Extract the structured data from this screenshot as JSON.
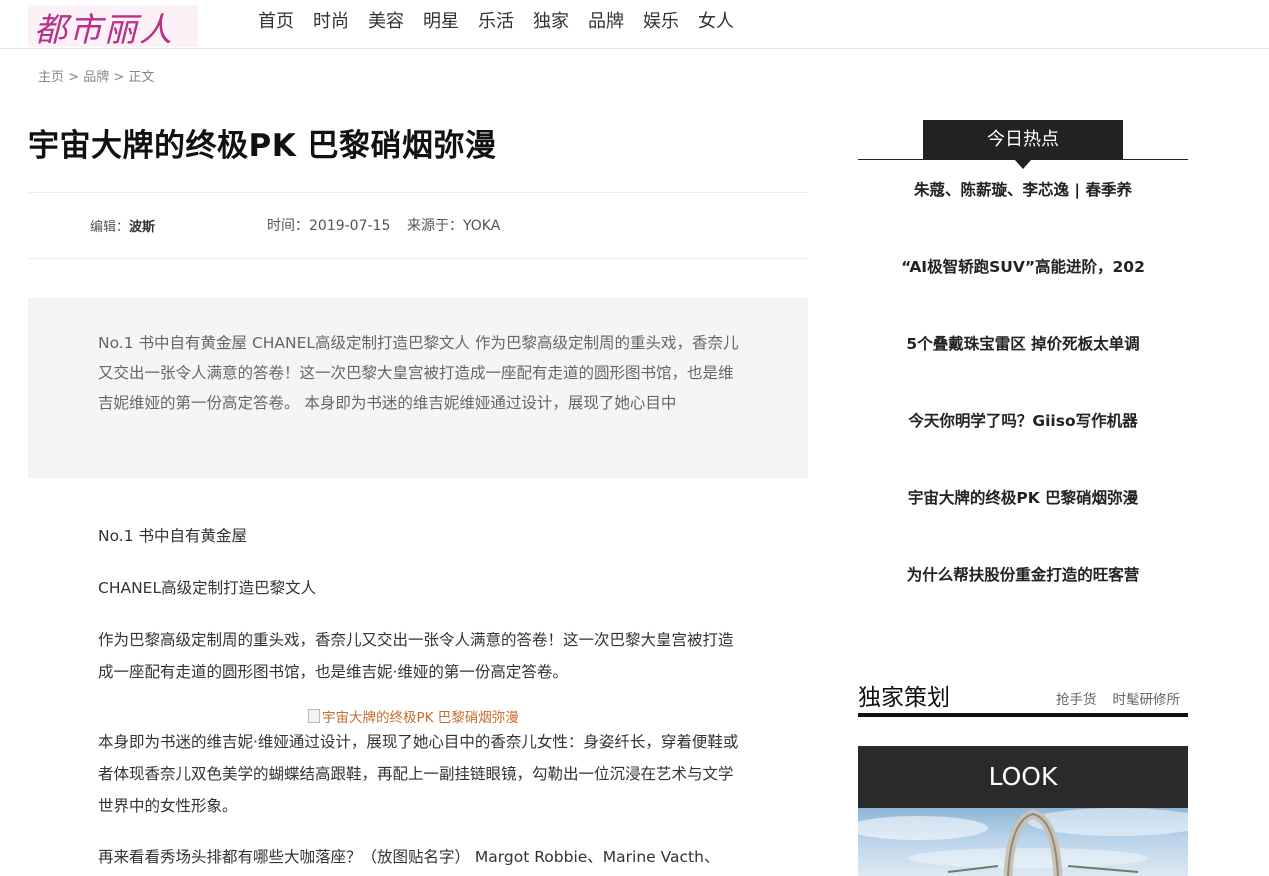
{
  "header": {
    "logo_text": "都市丽人",
    "nav": [
      "首页",
      "时尚",
      "美容",
      "明星",
      "乐活",
      "独家",
      "品牌",
      "娱乐",
      "女人"
    ]
  },
  "breadcrumb": {
    "home": "主页",
    "sep1": ">",
    "category": "品牌",
    "sep2": ">",
    "current": "正文"
  },
  "article": {
    "title": "宇宙大牌的终极PK 巴黎硝烟弥漫",
    "editor_label": "编辑：",
    "editor_name": "波斯",
    "time": "时间：2019-07-15",
    "source": "来源于：YOKA",
    "summary": "No.1 书中自有黄金屋 CHANEL高级定制打造巴黎文人 作为巴黎高级定制周的重头戏，香奈儿又交出一张令人满意的答卷！这一次巴黎大皇宫被打造成一座配有走道的圆形图书馆，也是维吉妮维娅的第一份高定答卷。 本身即为书迷的维吉妮维娅通过设计，展现了她心目中",
    "paragraphs": [
      "No.1 书中自有黄金屋",
      "CHANEL高级定制打造巴黎文人",
      "作为巴黎高级定制周的重头戏，香奈儿又交出一张令人满意的答卷！这一次巴黎大皇宫被打造成一座配有走道的圆形图书馆，也是维吉妮·维娅的第一份高定答卷。",
      "本身即为书迷的维吉妮·维娅通过设计，展现了她心目中的香奈儿女性：身姿纤长，穿着便鞋或者体现香奈儿双色美学的蝴蝶结高跟鞋，再配上一副挂链眼镜，勾勒出一位沉浸在艺术与文学世界中的女性形象。",
      "再来看看秀场头排都有哪些大咖落座？（放图贴名字） Margot Robbie、Marine Vacth、"
    ],
    "image_alt": "宇宙大牌的终极PK 巴黎硝烟弥漫"
  },
  "sidebar": {
    "hot_title": "今日热点",
    "hot_items": [
      "朱蔻、陈薪璇、李芯逸 | 春季养",
      "“AI极智轿跑SUV”高能进阶，202",
      "5个叠戴珠宝雷区 掉价死板太单调",
      "今天你明学了吗？Giiso写作机器",
      "宇宙大牌的终极PK 巴黎硝烟弥漫",
      "为什么帮扶股份重金打造的旺客营"
    ],
    "plan_title": "独家策划",
    "plan_links": [
      "抢手货",
      "时髦研修所"
    ],
    "look_label": "LOOK"
  }
}
